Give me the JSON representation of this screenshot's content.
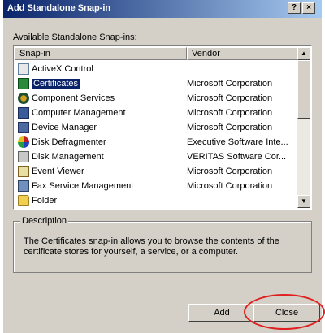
{
  "window": {
    "title": "Add Standalone Snap-in",
    "help_glyph": "?",
    "close_glyph": "×"
  },
  "list": {
    "label": "Available Standalone Snap-ins:",
    "columns": {
      "snapin": "Snap-in",
      "vendor": "Vendor"
    },
    "rows": [
      {
        "name": "ActiveX Control",
        "vendor": "",
        "icon": "activex-icon"
      },
      {
        "name": "Certificates",
        "vendor": "Microsoft Corporation",
        "icon": "certificates-icon",
        "selected": true
      },
      {
        "name": "Component Services",
        "vendor": "Microsoft Corporation",
        "icon": "component-services-icon"
      },
      {
        "name": "Computer Management",
        "vendor": "Microsoft Corporation",
        "icon": "computer-management-icon"
      },
      {
        "name": "Device Manager",
        "vendor": "Microsoft Corporation",
        "icon": "device-manager-icon"
      },
      {
        "name": "Disk Defragmenter",
        "vendor": "Executive Software Inte...",
        "icon": "disk-defragmenter-icon"
      },
      {
        "name": "Disk Management",
        "vendor": "VERITAS Software Cor...",
        "icon": "disk-management-icon"
      },
      {
        "name": "Event Viewer",
        "vendor": "Microsoft Corporation",
        "icon": "event-viewer-icon"
      },
      {
        "name": "Fax Service Management",
        "vendor": "Microsoft Corporation",
        "icon": "fax-service-icon"
      },
      {
        "name": "Folder",
        "vendor": "",
        "icon": "folder-icon"
      }
    ]
  },
  "scrollbar": {
    "up_glyph": "▲",
    "down_glyph": "▼"
  },
  "description": {
    "legend": "Description",
    "text": "The Certificates snap-in allows you to browse the contents of the certificate stores for yourself, a service, or a computer."
  },
  "buttons": {
    "add": "Add",
    "close": "Close"
  },
  "colors": {
    "titlebar_start": "#0a246a",
    "titlebar_end": "#a6caf0",
    "selection": "#0a246a",
    "highlight_ellipse": "#e02020"
  }
}
